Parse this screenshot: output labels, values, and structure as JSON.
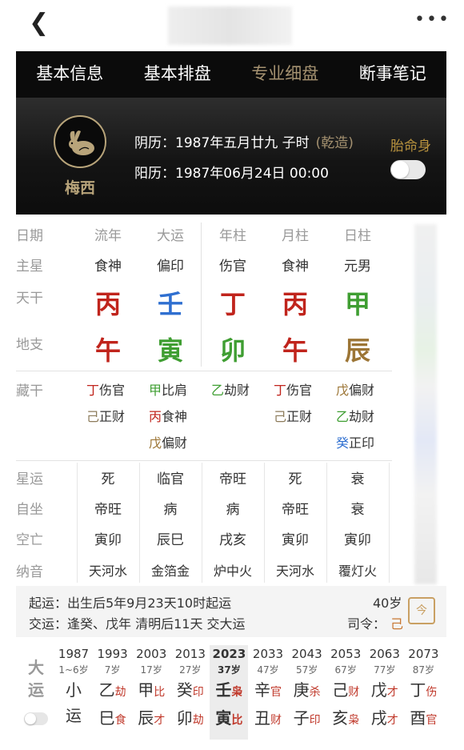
{
  "topbar": {
    "back_icon": "back-chevron-icon",
    "more_icon": "more-dots-icon"
  },
  "nav": {
    "tabs": [
      "基本信息",
      "基本排盘",
      "专业细盘",
      "断事笔记"
    ],
    "active": 2
  },
  "header": {
    "name": "梅西",
    "lunar_label": "阴历：",
    "lunar": "1987年五月廿九 子时",
    "gender": "(乾造)",
    "solar_label": "阳历：",
    "solar": "1987年06月24日 00:00",
    "taiming_label": "胎命身"
  },
  "pillars": {
    "row_labels": [
      "日期",
      "主星",
      "天干",
      "地支"
    ],
    "headers": [
      "流年",
      "大运",
      "年柱",
      "月柱",
      "日柱"
    ],
    "main_star": [
      "食神",
      "偏印",
      "伤官",
      "食神",
      "元男"
    ],
    "tiangan": [
      "丙",
      "壬",
      "丁",
      "丙",
      "甲"
    ],
    "dizhi": [
      "午",
      "寅",
      "卯",
      "午",
      "辰"
    ]
  },
  "canggan_label": "藏干",
  "canggan": [
    [
      {
        "c": "丁",
        "t": "伤官"
      },
      {
        "c": "己",
        "t": "正财"
      }
    ],
    [
      {
        "c": "甲",
        "t": "比肩"
      },
      {
        "c": "丙",
        "t": "食神"
      },
      {
        "c": "戊",
        "t": "偏财"
      }
    ],
    [
      {
        "c": "乙",
        "t": "劫财"
      }
    ],
    [
      {
        "c": "丁",
        "t": "伤官"
      },
      {
        "c": "己",
        "t": "正财"
      }
    ],
    [
      {
        "c": "戊",
        "t": "偏财"
      },
      {
        "c": "乙",
        "t": "劫财"
      },
      {
        "c": "癸",
        "t": "正印"
      }
    ]
  ],
  "misc": {
    "labels": [
      "星运",
      "自坐",
      "空亡",
      "纳音"
    ],
    "rows": [
      [
        "死",
        "临官",
        "帝旺",
        "死",
        "衰"
      ],
      [
        "帝旺",
        "病",
        "病",
        "帝旺",
        "衰"
      ],
      [
        "寅卯",
        "辰巳",
        "戌亥",
        "寅卯",
        "寅卯"
      ],
      [
        "天河水",
        "金箔金",
        "炉中火",
        "天河水",
        "覆灯火"
      ]
    ]
  },
  "info": {
    "qiyun": "起运：出生后5年9月23天10时起运",
    "jiaoyun": "交运：逢癸、戊年 清明后11天 交大运",
    "age": "40岁",
    "siling_label": "司令：",
    "siling_value": "己",
    "calendar_icon": "calendar-icon",
    "calendar_text": "今"
  },
  "dayun": {
    "label": "大运",
    "current": 4,
    "columns": [
      {
        "year": "1987",
        "age": "1~6岁",
        "g": "小",
        "gs": "",
        "z": "运",
        "zs": ""
      },
      {
        "year": "1993",
        "age": "7岁",
        "g": "乙",
        "gs": "劫",
        "z": "巳",
        "zs": "食"
      },
      {
        "year": "2003",
        "age": "17岁",
        "g": "甲",
        "gs": "比",
        "z": "辰",
        "zs": "才"
      },
      {
        "year": "2013",
        "age": "27岁",
        "g": "癸",
        "gs": "印",
        "z": "卯",
        "zs": "劫"
      },
      {
        "year": "2023",
        "age": "37岁",
        "g": "壬",
        "gs": "枭",
        "z": "寅",
        "zs": "比"
      },
      {
        "year": "2033",
        "age": "47岁",
        "g": "辛",
        "gs": "官",
        "z": "丑",
        "zs": "财"
      },
      {
        "year": "2043",
        "age": "57岁",
        "g": "庚",
        "gs": "杀",
        "z": "子",
        "zs": "印"
      },
      {
        "year": "2053",
        "age": "67岁",
        "g": "己",
        "gs": "财",
        "z": "亥",
        "zs": "枭"
      },
      {
        "year": "2063",
        "age": "77岁",
        "g": "戊",
        "gs": "才",
        "z": "戌",
        "zs": "才"
      },
      {
        "year": "2073",
        "age": "87岁",
        "g": "丁",
        "gs": "伤",
        "z": "酉",
        "zs": "官"
      }
    ]
  },
  "colors": {
    "fire": "#c0241c",
    "water": "#2f6fd0",
    "wood": "#3f9e32",
    "earth": "#9c7535",
    "metal": "#8c7b5a",
    "gold": "#a49170"
  }
}
